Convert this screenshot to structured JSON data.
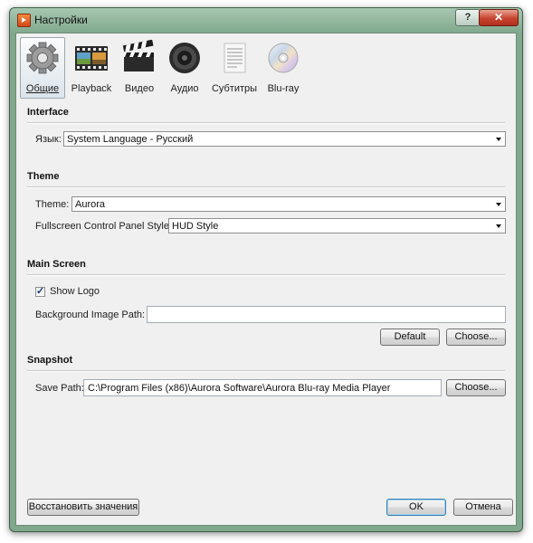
{
  "window": {
    "title": "Настройки",
    "help_label": "?",
    "close_label": "✕"
  },
  "tabs": [
    {
      "label": "Общие",
      "icon": "gear-icon",
      "active": true
    },
    {
      "label": "Playback",
      "icon": "film-strip-icon",
      "active": false
    },
    {
      "label": "Видео",
      "icon": "clapperboard-icon",
      "active": false
    },
    {
      "label": "Аудио",
      "icon": "speaker-icon",
      "active": false
    },
    {
      "label": "Субтитры",
      "icon": "document-icon",
      "active": false
    },
    {
      "label": "Blu-ray",
      "icon": "disc-icon",
      "active": false
    }
  ],
  "interface": {
    "section_title": "Interface",
    "language_label": "Язык:",
    "language_value": "System Language - Русский"
  },
  "theme": {
    "section_title": "Theme",
    "theme_label": "Theme:",
    "theme_value": "Aurora",
    "fullscreen_label": "Fullscreen Control Panel Style:",
    "fullscreen_value": "HUD Style"
  },
  "main_screen": {
    "section_title": "Main Screen",
    "show_logo_label": "Show Logo",
    "show_logo_checked": true,
    "bg_path_label": "Background Image Path:",
    "bg_path_value": "",
    "default_button": "Default",
    "choose_button": "Choose..."
  },
  "snapshot": {
    "section_title": "Snapshot",
    "save_path_label": "Save Path:",
    "save_path_value": "C:\\Program Files (x86)\\Aurora Software\\Aurora Blu-ray Media Player",
    "choose_button": "Choose..."
  },
  "footer": {
    "restore_button": "Восстановить значения",
    "ok_button": "OK",
    "cancel_button": "Отмена"
  }
}
